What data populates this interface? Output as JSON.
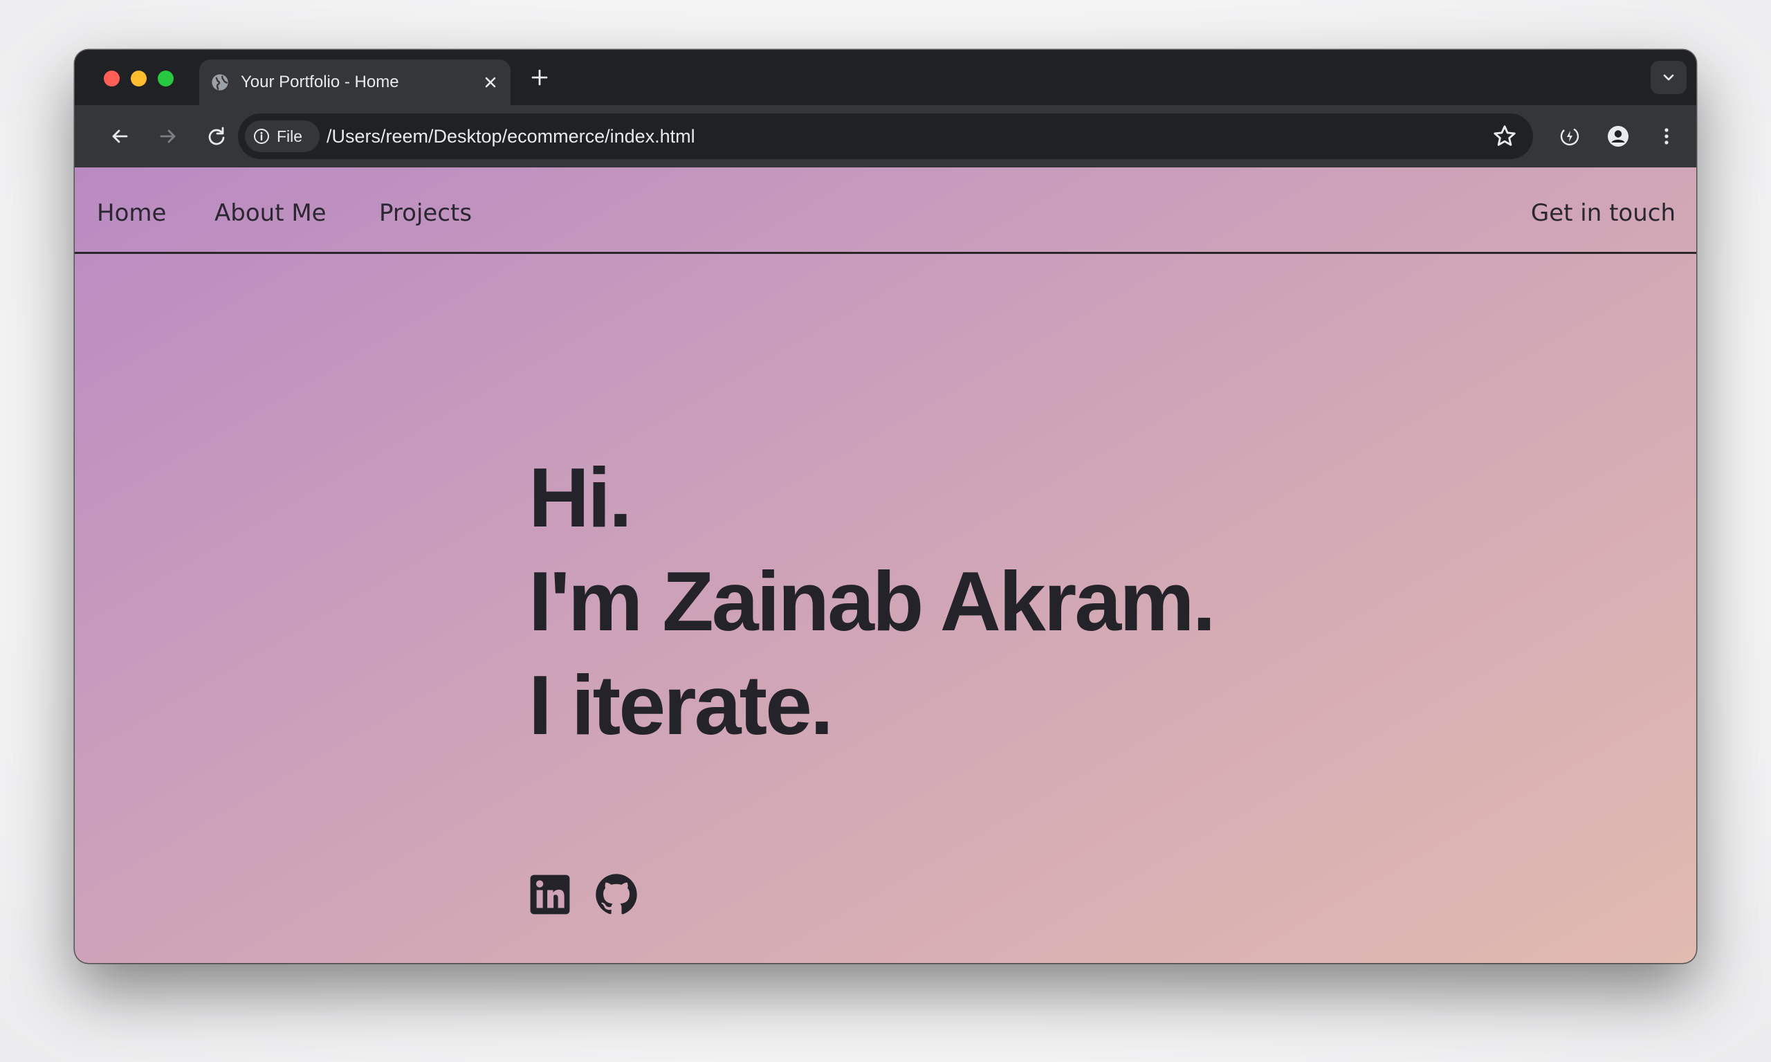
{
  "browser": {
    "tab_title": "Your Portfolio - Home",
    "file_chip_label": "File",
    "url": "/Users/reem/Desktop/ecommerce/index.html"
  },
  "nav": {
    "links": [
      {
        "label": "Home"
      },
      {
        "label": "About Me"
      },
      {
        "label": "Projects"
      }
    ],
    "cta": "Get in touch"
  },
  "hero": {
    "lines": [
      "Hi.",
      "I'm Zainab Akram.",
      "I iterate."
    ]
  },
  "social": {
    "icons": [
      "linkedin-icon",
      "github-icon"
    ]
  },
  "colors": {
    "gradient_start": "#b98ac2",
    "gradient_end": "#e1bab0",
    "text": "#25232a",
    "chrome_dark": "#202124",
    "chrome_toolbar": "#35363a"
  }
}
